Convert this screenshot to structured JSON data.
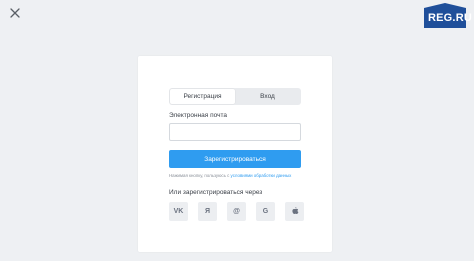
{
  "logo": {
    "text": "REG.RU"
  },
  "tabs": [
    {
      "label": "Регистрация",
      "active": true
    },
    {
      "label": "Вход",
      "active": false
    }
  ],
  "form": {
    "email_label": "Электронная почта",
    "email_value": "",
    "submit_label": "Зарегистрироваться",
    "consent_text": "Нажимая кнопку, пользуюсь с",
    "consent_link": "условиями обработки данных"
  },
  "social": {
    "label": "Или зарегистрироваться через",
    "providers": [
      {
        "name": "vk",
        "glyph": "VK",
        "icon": "vk-icon"
      },
      {
        "name": "yandex",
        "glyph": "Я",
        "icon": "yandex-icon"
      },
      {
        "name": "mailru",
        "glyph": "@",
        "icon": "mailru-icon"
      },
      {
        "name": "google",
        "glyph": "G",
        "icon": "google-icon"
      },
      {
        "name": "apple",
        "glyph": "",
        "icon": "apple-icon"
      }
    ]
  },
  "colors": {
    "accent": "#2f9cf0",
    "brand": "#1f4f9a",
    "background": "#eef0f3"
  }
}
